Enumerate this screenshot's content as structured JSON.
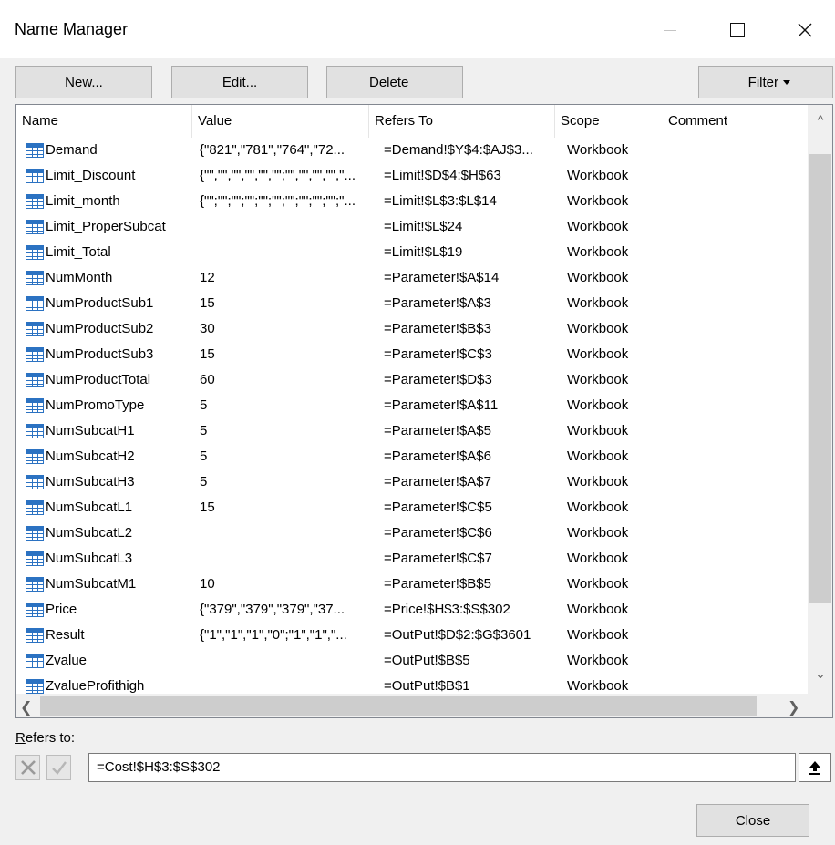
{
  "window": {
    "title": "Name Manager",
    "minimize_icon": "minimize-icon",
    "maximize_icon": "maximize-icon",
    "close_icon": "close-icon"
  },
  "toolbar": {
    "new_prefix": "",
    "new_accel": "N",
    "new_suffix": "ew...",
    "edit_prefix": "",
    "edit_accel": "E",
    "edit_suffix": "dit...",
    "delete_prefix": "",
    "delete_accel": "D",
    "delete_suffix": "elete",
    "filter_prefix": "",
    "filter_accel": "F",
    "filter_suffix": "ilter"
  },
  "table": {
    "columns": [
      "Name",
      "Value",
      "Refers To",
      "Scope",
      "Comment"
    ],
    "rows": [
      {
        "name": "Demand",
        "value": "{\"821\",\"781\",\"764\",\"72...",
        "refers_to": "=Demand!$Y$4:$AJ$3...",
        "scope": "Workbook",
        "comment": ""
      },
      {
        "name": "Limit_Discount",
        "value": "{\"\",\"\",\"\",\"\",\"\",\"\";\"\",\"\",\"\",\"\",\"...",
        "refers_to": "=Limit!$D$4:$H$63",
        "scope": "Workbook",
        "comment": ""
      },
      {
        "name": "Limit_month",
        "value": "{\"\";\"\";\"\";\"\";\"\";\"\";\"\";\"\";\"\";\"\";\"...",
        "refers_to": "=Limit!$L$3:$L$14",
        "scope": "Workbook",
        "comment": ""
      },
      {
        "name": "Limit_ProperSubcat",
        "value": "",
        "refers_to": "=Limit!$L$24",
        "scope": "Workbook",
        "comment": ""
      },
      {
        "name": "Limit_Total",
        "value": "",
        "refers_to": "=Limit!$L$19",
        "scope": "Workbook",
        "comment": ""
      },
      {
        "name": "NumMonth",
        "value": "12",
        "refers_to": "=Parameter!$A$14",
        "scope": "Workbook",
        "comment": ""
      },
      {
        "name": "NumProductSub1",
        "value": "15",
        "refers_to": "=Parameter!$A$3",
        "scope": "Workbook",
        "comment": ""
      },
      {
        "name": "NumProductSub2",
        "value": "30",
        "refers_to": "=Parameter!$B$3",
        "scope": "Workbook",
        "comment": ""
      },
      {
        "name": "NumProductSub3",
        "value": "15",
        "refers_to": "=Parameter!$C$3",
        "scope": "Workbook",
        "comment": ""
      },
      {
        "name": "NumProductTotal",
        "value": "60",
        "refers_to": "=Parameter!$D$3",
        "scope": "Workbook",
        "comment": ""
      },
      {
        "name": "NumPromoType",
        "value": "5",
        "refers_to": "=Parameter!$A$11",
        "scope": "Workbook",
        "comment": ""
      },
      {
        "name": "NumSubcatH1",
        "value": "5",
        "refers_to": "=Parameter!$A$5",
        "scope": "Workbook",
        "comment": ""
      },
      {
        "name": "NumSubcatH2",
        "value": "5",
        "refers_to": "=Parameter!$A$6",
        "scope": "Workbook",
        "comment": ""
      },
      {
        "name": "NumSubcatH3",
        "value": "5",
        "refers_to": "=Parameter!$A$7",
        "scope": "Workbook",
        "comment": ""
      },
      {
        "name": "NumSubcatL1",
        "value": "15",
        "refers_to": "=Parameter!$C$5",
        "scope": "Workbook",
        "comment": ""
      },
      {
        "name": "NumSubcatL2",
        "value": "",
        "refers_to": "=Parameter!$C$6",
        "scope": "Workbook",
        "comment": ""
      },
      {
        "name": "NumSubcatL3",
        "value": "",
        "refers_to": "=Parameter!$C$7",
        "scope": "Workbook",
        "comment": ""
      },
      {
        "name": "NumSubcatM1",
        "value": "10",
        "refers_to": "=Parameter!$B$5",
        "scope": "Workbook",
        "comment": ""
      },
      {
        "name": "Price",
        "value": "{\"379\",\"379\",\"379\",\"37...",
        "refers_to": "=Price!$H$3:$S$302",
        "scope": "Workbook",
        "comment": ""
      },
      {
        "name": "Result",
        "value": "{\"1\",\"1\",\"1\",\"0\";\"1\",\"1\",\"...",
        "refers_to": "=OutPut!$D$2:$G$3601",
        "scope": "Workbook",
        "comment": ""
      },
      {
        "name": "Zvalue",
        "value": "",
        "refers_to": "=OutPut!$B$5",
        "scope": "Workbook",
        "comment": ""
      },
      {
        "name": "ZvalueProfithigh",
        "value": "",
        "refers_to": "=OutPut!$B$1",
        "scope": "Workbook",
        "comment": ""
      }
    ]
  },
  "refers_to": {
    "label_accel": "R",
    "label_rest": "efers to:",
    "value": "=Cost!$H$3:$S$302",
    "cancel_icon": "cancel-x-icon",
    "confirm_icon": "check-icon",
    "collapse_icon": "collapse-dialog-icon"
  },
  "footer": {
    "close_label": "Close"
  }
}
